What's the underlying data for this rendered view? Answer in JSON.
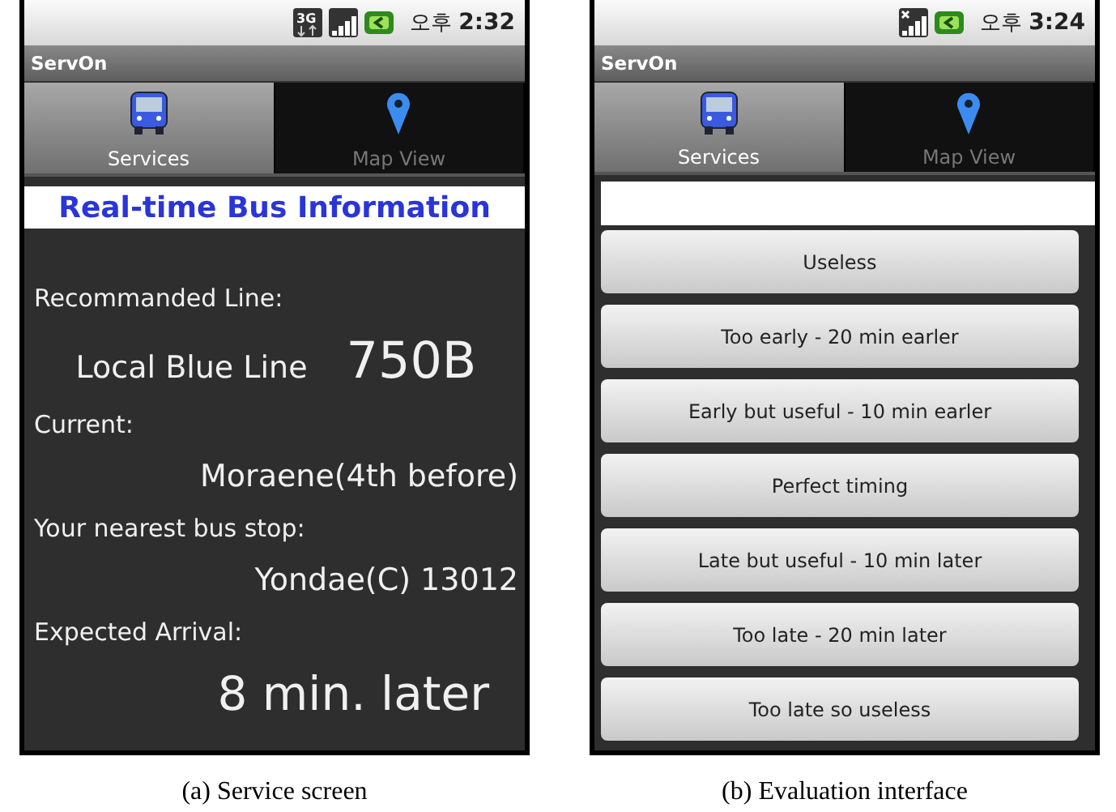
{
  "figures": [
    {
      "phone": {
        "status_bar": {
          "network": "3G",
          "has_signal": true,
          "period": "오후",
          "time": "2:32"
        },
        "app_title": "ServOn",
        "tabs": [
          {
            "label": "Services",
            "selected": true
          },
          {
            "label": "Map View",
            "selected": false
          }
        ],
        "screen": {
          "kind": "info",
          "heading": "Real-time Bus Information",
          "items": [
            {
              "kind": "label",
              "text": "Recommanded Line:"
            },
            {
              "kind": "line",
              "name": "Local Blue Line",
              "code": "750B"
            },
            {
              "kind": "label",
              "text": "Current:"
            },
            {
              "kind": "value",
              "text": "Moraene(4th before)"
            },
            {
              "kind": "label",
              "text": "Your nearest bus stop:"
            },
            {
              "kind": "value",
              "text": "Yondae(C) 13012"
            },
            {
              "kind": "label",
              "text": "Expected Arrival:"
            },
            {
              "kind": "big",
              "text": "8 min. later"
            }
          ]
        }
      },
      "caption": "(a) Service screen"
    },
    {
      "phone": {
        "status_bar": {
          "has_signal": false,
          "period": "오후",
          "time": "3:24"
        },
        "app_title": "ServOn",
        "tabs": [
          {
            "label": "Services",
            "selected": true
          },
          {
            "label": "Map View",
            "selected": false
          }
        ],
        "screen": {
          "kind": "evaluation",
          "buttons": [
            "Useless",
            "Too early - 20 min earler",
            "Early but useful - 10 min earler",
            "Perfect timing",
            "Late but useful - 10 min later",
            "Too late - 20 min later",
            "Too late so useless"
          ]
        }
      },
      "caption": "(b) Evaluation interface"
    }
  ]
}
